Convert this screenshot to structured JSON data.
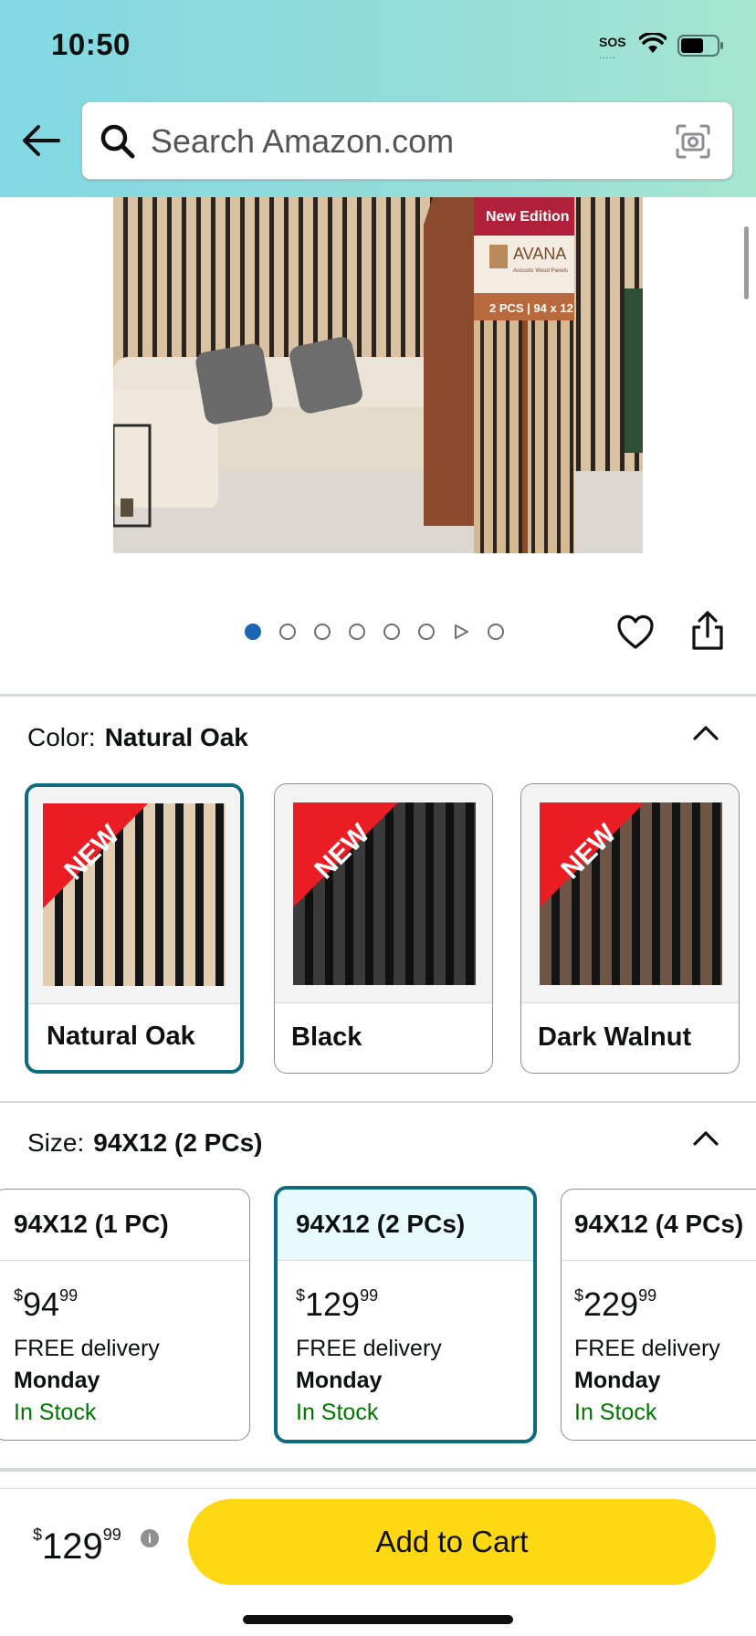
{
  "status_bar": {
    "time": "10:50",
    "sos": "SOS",
    "sos_dots": "....."
  },
  "search": {
    "placeholder": "Search Amazon.com"
  },
  "product_image": {
    "box_badge": "New Edition",
    "box_brand": "AVANA",
    "box_tagline": "Acoustic Wood Panels",
    "box_spec": "2 PCS | 94 x 12"
  },
  "carousel": {
    "total_dots": 8,
    "active_index": 0
  },
  "color": {
    "label": "Color:",
    "selected_value": "Natural Oak",
    "options": [
      {
        "label": "Natural Oak",
        "badge": "NEW",
        "selected": true
      },
      {
        "label": "Black",
        "badge": "NEW",
        "selected": false
      },
      {
        "label": "Dark Walnut",
        "badge": "NEW",
        "selected": false
      }
    ]
  },
  "size": {
    "label": "Size:",
    "selected_value": "94X12 (2 PCs)",
    "options": [
      {
        "label": "94X12 (1 PC)",
        "price_whole": "94",
        "price_cents": "99",
        "currency": "$",
        "delivery": "FREE delivery",
        "day": "Monday",
        "stock": "In Stock",
        "selected": false
      },
      {
        "label": "94X12 (2 PCs)",
        "price_whole": "129",
        "price_cents": "99",
        "currency": "$",
        "delivery": "FREE delivery",
        "day": "Monday",
        "stock": "In Stock",
        "selected": true
      },
      {
        "label": "94X12 (4 PCs)",
        "price_whole": "229",
        "price_cents": "99",
        "currency": "$",
        "delivery": "FREE delivery",
        "day": "Monday",
        "stock": "In Stock",
        "selected": false
      }
    ]
  },
  "bottom_bar": {
    "currency": "$",
    "price_whole": "129",
    "price_cents": "99",
    "info": "i",
    "add_to_cart": "Add to Cart"
  },
  "colors": {
    "accent_teal": "#0f6c7e",
    "cart_yellow": "#ffd814",
    "stock_green": "#007600",
    "dot_blue": "#1d64b5"
  }
}
